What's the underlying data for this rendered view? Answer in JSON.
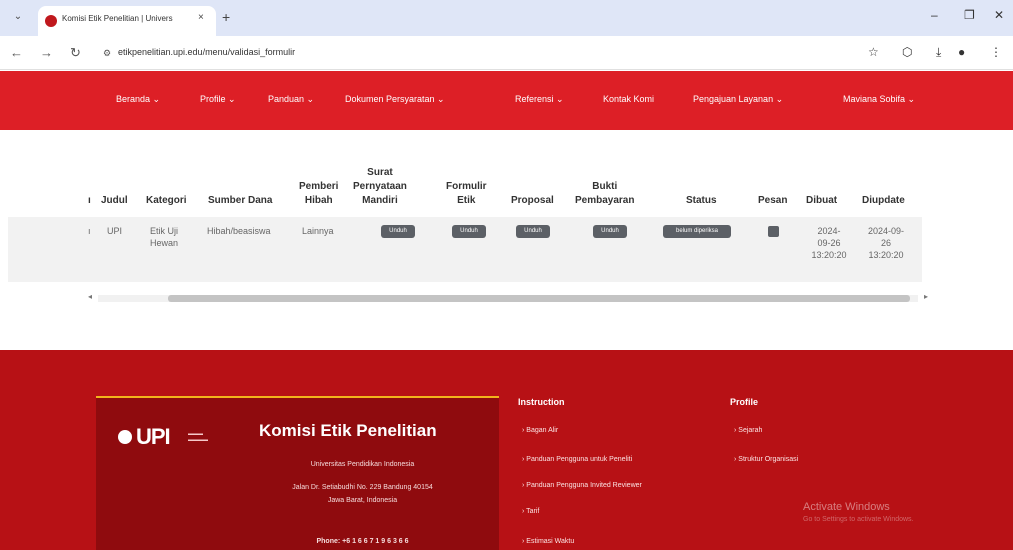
{
  "browser": {
    "tab_title": "Komisi Etik Penelitian | Univers",
    "tab_close": "×",
    "new_tab": "+",
    "url": "etikpenelitian.upi.edu/menu/validasi_formulir",
    "window_controls": [
      "–",
      "❐",
      "✕"
    ],
    "nav": {
      "back": "←",
      "forward": "→",
      "reload": "↻"
    }
  },
  "nav": {
    "items": [
      "Beranda ⌄",
      "Profile ⌄",
      "Panduan ⌄",
      "Dokumen Persyaratan ⌄",
      "Referensi ⌄",
      "Kontak Komi",
      "Pengajuan Layanan ⌄",
      "Maviana Sobifa ⌄"
    ]
  },
  "table": {
    "headers": [
      "Judul",
      "Kategori",
      "Sumber Dana",
      "Pemberi\nHibah",
      "Surat\nPernyataan\nMandiri",
      "Formulir\nEtik",
      "Proposal",
      "Bukti\nPembayaran",
      "Status",
      "Pesan",
      "Dibuat",
      "Diupdate"
    ],
    "row": {
      "judul": "UPI",
      "kategori": "Etik Uji Hewan",
      "sumber_dana": "Hibah/beasiswa",
      "pemberi_hibah": "Lainnya",
      "surat_button": "Unduh",
      "formulir_button": "Unduh",
      "proposal_button": "Unduh",
      "bukti_button": "Unduh",
      "status_badge": "belum diperiksa",
      "dibuat": "2024-09-26 13:20:20",
      "diupdate": "2024-09-26 13:20:20"
    }
  },
  "footer": {
    "brand_title": "Komisi Etik Penelitian",
    "logo_text": "UPI",
    "university": "Universitas Pendidikan Indonesia",
    "address1": "Jalan Dr. Setiabudhi No. 229 Bandung 40154",
    "address2": "Jawa Barat, Indonesia",
    "phone": "Phone: +6 1 6 6 7 1 9 6 3 6 6",
    "instruction_head": "Instruction",
    "instruction_links": [
      "› Bagan Alir",
      "› Panduan Pengguna untuk Peneliti",
      "› Panduan Pengguna Invited Reviewer",
      "› Tarif",
      "› Estimasi Waktu"
    ],
    "profile_head": "Profile",
    "profile_links": [
      "› Sejarah",
      "› Struktur Organisasi"
    ],
    "watermark_title": "Activate Windows",
    "watermark_sub": "Go to Settings to activate Windows."
  },
  "colors": {
    "nav_red": "#dd1f26",
    "footer_red": "#b71115",
    "badge_gray": "#5c6066",
    "accent_gold": "#f2b41c"
  }
}
